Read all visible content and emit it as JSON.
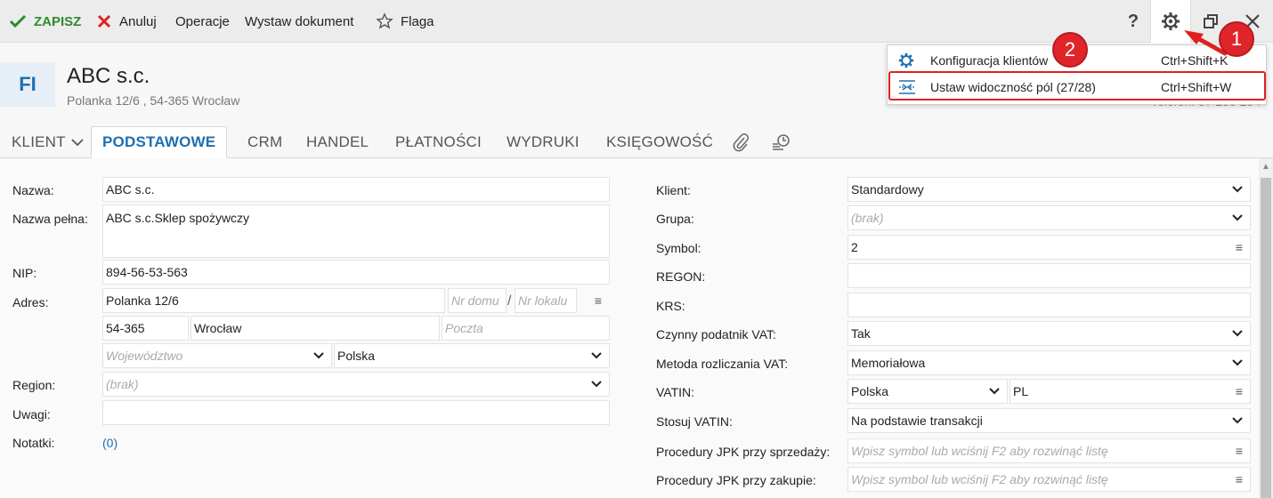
{
  "toolbar": {
    "save": "ZAPISZ",
    "cancel": "Anuluj",
    "operations": "Operacje",
    "issue_document": "Wystaw dokument",
    "flag": "Flaga",
    "help": "?"
  },
  "header": {
    "avatar": "FI",
    "name": "ABC s.c.",
    "address": "Polanka  12/6 , 54-365 Wrocław",
    "phone": "Telefon: 57 235 254"
  },
  "menu": {
    "items": [
      {
        "label": "Konfiguracja klientów",
        "shortcut": "Ctrl+Shift+K"
      },
      {
        "label": "Ustaw widoczność pól (27/28)",
        "shortcut": "Ctrl+Shift+W"
      }
    ]
  },
  "annotations": {
    "badge1": "1",
    "badge2": "2"
  },
  "tabs": {
    "client": "KLIENT",
    "basic": "PODSTAWOWE",
    "crm": "CRM",
    "trade": "HANDEL",
    "payments": "PŁATNOŚCI",
    "printouts": "WYDRUKI",
    "accounting": "KSIĘGOWOŚĆ"
  },
  "left": {
    "name_label": "Nazwa:",
    "name": "ABC s.c.",
    "full_name_label": "Nazwa pełna:",
    "full_name": "ABC s.c.Sklep spożywczy",
    "nip_label": "NIP:",
    "nip": "894-56-53-563",
    "address_label": "Adres:",
    "street": "Polanka  12/6",
    "house_no_ph": "Nr domu",
    "flat_no_ph": "Nr lokalu",
    "postal_code": "54-365",
    "city": "Wrocław",
    "post_office_ph": "Poczta",
    "voivodeship_ph": "Województwo",
    "country": "Polska",
    "region_label": "Region:",
    "region": "(brak)",
    "notes_label": "Uwagi:",
    "notes": "",
    "memos_label": "Notatki:",
    "memos": "(0)"
  },
  "right": {
    "client_label": "Klient:",
    "client": "Standardowy",
    "group_label": "Grupa:",
    "group": "(brak)",
    "symbol_label": "Symbol:",
    "symbol": "2",
    "regon_label": "REGON:",
    "regon": "",
    "krs_label": "KRS:",
    "krs": "",
    "vat_payer_label": "Czynny podatnik VAT:",
    "vat_payer": "Tak",
    "vat_method_label": "Metoda rozliczania VAT:",
    "vat_method": "Memoriałowa",
    "vatin_label": "VATIN:",
    "vatin_country": "Polska",
    "vatin_code": "PL",
    "apply_vatin_label": "Stosuj VATIN:",
    "apply_vatin": "Na podstawie transakcji",
    "jpk_sale_label": "Procedury JPK przy sprzedaży:",
    "jpk_sale_ph": "Wpisz symbol lub wciśnij F2 aby rozwinąć listę",
    "jpk_purchase_label": "Procedury JPK przy zakupie:",
    "jpk_purchase_ph": "Wpisz symbol lub wciśnij F2 aby rozwinąć listę"
  }
}
